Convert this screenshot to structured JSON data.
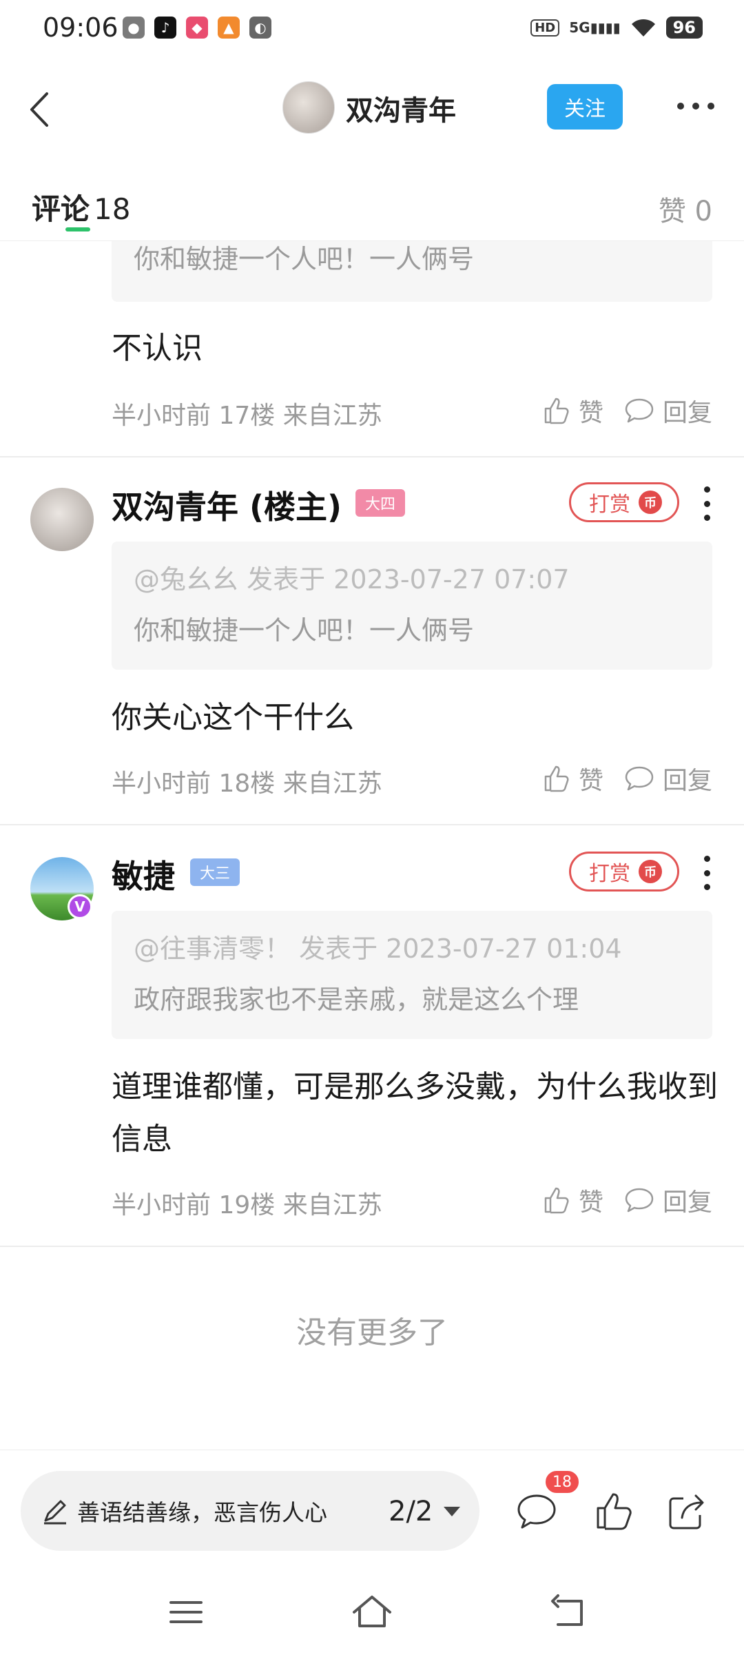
{
  "status_bar": {
    "time": "09:06",
    "network": "5G",
    "hd": "HD",
    "battery": "96"
  },
  "nav": {
    "title": "双沟青年",
    "follow_label": "关注"
  },
  "tabs": {
    "comments_label": "评论",
    "comments_count": "18",
    "likes_label": "赞 0"
  },
  "comments": [
    {
      "quote_text": "你和敏捷一个人吧！一人俩号",
      "text": "不认识",
      "meta": "半小时前  17楼  来自江苏",
      "like_label": "赞",
      "reply_label": "回复"
    },
    {
      "username": "双沟青年 (楼主)",
      "grade": "大四",
      "tip_label": "打赏",
      "quote_meta": "@兔幺幺 发表于 2023-07-27 07:07",
      "quote_text": "你和敏捷一个人吧！一人俩号",
      "text": "你关心这个干什么",
      "meta": "半小时前  18楼  来自江苏",
      "like_label": "赞",
      "reply_label": "回复"
    },
    {
      "username": "敏捷",
      "grade": "大三",
      "tip_label": "打赏",
      "quote_meta": "@往事清零！  发表于 2023-07-27 01:04",
      "quote_text": "政府跟我家也不是亲戚，就是这么个理",
      "text": "道理谁都懂，可是那么多没戴，为什么我收到信息",
      "meta": "半小时前  19楼  来自江苏",
      "like_label": "赞",
      "reply_label": "回复"
    }
  ],
  "footer_note": "没有更多了",
  "bottom_bar": {
    "input_placeholder": "善语结善缘，恶言伤人心",
    "page_indicator": "2/2",
    "comment_badge": "18"
  },
  "icons": {
    "tip_coin": "币",
    "verified": "V"
  }
}
